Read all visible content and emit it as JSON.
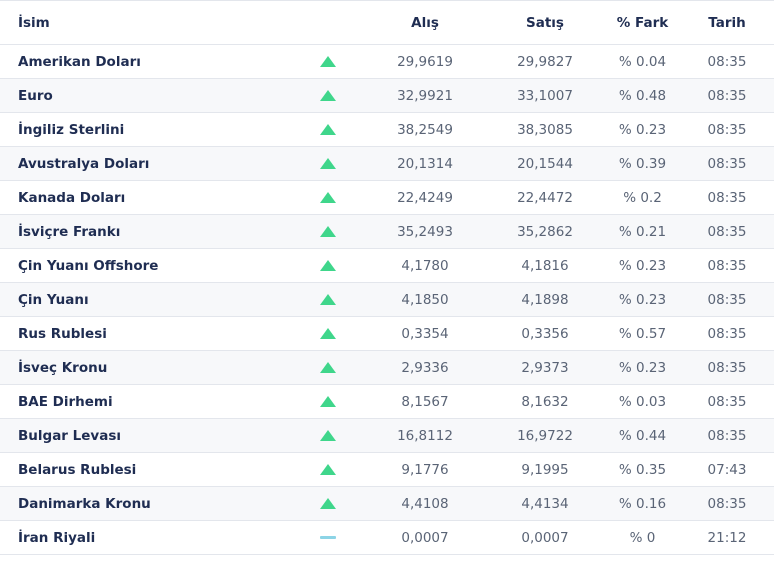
{
  "header": {
    "name": "İsim",
    "buy": "Alış",
    "sell": "Satış",
    "diff": "% Fark",
    "time": "Tarih"
  },
  "colors": {
    "up": "#3fd68b",
    "flat": "#8cd4e6",
    "text": "#1f2d52"
  },
  "rows": [
    {
      "name": "Amerikan Doları",
      "trend": "up",
      "buy": "29,9619",
      "sell": "29,9827",
      "diff": "% 0.04",
      "time": "08:35"
    },
    {
      "name": "Euro",
      "trend": "up",
      "buy": "32,9921",
      "sell": "33,1007",
      "diff": "% 0.48",
      "time": "08:35"
    },
    {
      "name": "İngiliz Sterlini",
      "trend": "up",
      "buy": "38,2549",
      "sell": "38,3085",
      "diff": "% 0.23",
      "time": "08:35"
    },
    {
      "name": "Avustralya Doları",
      "trend": "up",
      "buy": "20,1314",
      "sell": "20,1544",
      "diff": "% 0.39",
      "time": "08:35"
    },
    {
      "name": "Kanada Doları",
      "trend": "up",
      "buy": "22,4249",
      "sell": "22,4472",
      "diff": "% 0.2",
      "time": "08:35"
    },
    {
      "name": "İsviçre Frankı",
      "trend": "up",
      "buy": "35,2493",
      "sell": "35,2862",
      "diff": "% 0.21",
      "time": "08:35"
    },
    {
      "name": "Çin Yuanı Offshore",
      "trend": "up",
      "buy": "4,1780",
      "sell": "4,1816",
      "diff": "% 0.23",
      "time": "08:35"
    },
    {
      "name": "Çin Yuanı",
      "trend": "up",
      "buy": "4,1850",
      "sell": "4,1898",
      "diff": "% 0.23",
      "time": "08:35"
    },
    {
      "name": "Rus Rublesi",
      "trend": "up",
      "buy": "0,3354",
      "sell": "0,3356",
      "diff": "% 0.57",
      "time": "08:35"
    },
    {
      "name": "İsveç Kronu",
      "trend": "up",
      "buy": "2,9336",
      "sell": "2,9373",
      "diff": "% 0.23",
      "time": "08:35"
    },
    {
      "name": "BAE Dirhemi",
      "trend": "up",
      "buy": "8,1567",
      "sell": "8,1632",
      "diff": "% 0.03",
      "time": "08:35"
    },
    {
      "name": "Bulgar Levası",
      "trend": "up",
      "buy": "16,8112",
      "sell": "16,9722",
      "diff": "% 0.44",
      "time": "08:35"
    },
    {
      "name": "Belarus Rublesi",
      "trend": "up",
      "buy": "9,1776",
      "sell": "9,1995",
      "diff": "% 0.35",
      "time": "07:43"
    },
    {
      "name": "Danimarka Kronu",
      "trend": "up",
      "buy": "4,4108",
      "sell": "4,4134",
      "diff": "% 0.16",
      "time": "08:35"
    },
    {
      "name": "İran Riyali",
      "trend": "flat",
      "buy": "0,0007",
      "sell": "0,0007",
      "diff": "% 0",
      "time": "21:12"
    }
  ]
}
